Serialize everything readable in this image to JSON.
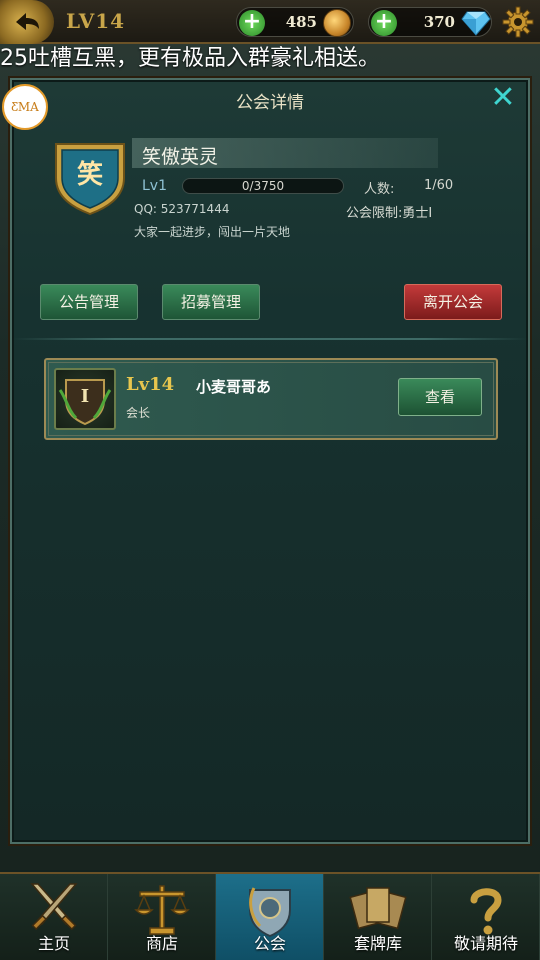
{
  "topbar": {
    "level": "LV14",
    "gold": "485",
    "gems": "370"
  },
  "marquee": "25吐槽互黑，更有极品入群豪礼相送。",
  "dialog": {
    "title": "公会详情",
    "close_label": "✕",
    "logo_text": "ƸMA",
    "guild": {
      "emblem_char": "笑",
      "name": "笑傲英灵",
      "level": "Lv1",
      "xp": "0/3750",
      "xp_fraction": 0,
      "members_label": "人数:",
      "members_value": "1/60",
      "qq": "QQ:  523771444",
      "limit": "公会限制:勇士Ⅰ",
      "motto": "大家一起进步，闯出一片天地"
    },
    "buttons": {
      "announcement": "公告管理",
      "recruit": "招募管理",
      "leave": "离开公会"
    },
    "members": [
      {
        "avatar_rank": "I",
        "level": "Lv14",
        "name": "小麦哥哥あ",
        "role": "会长",
        "view_label": "查看"
      }
    ]
  },
  "nav": {
    "items": [
      {
        "label": "主页",
        "icon": "crossed-swords-icon",
        "active": false
      },
      {
        "label": "商店",
        "icon": "scales-icon",
        "active": false
      },
      {
        "label": "公会",
        "icon": "guild-crest-icon",
        "active": true
      },
      {
        "label": "套牌库",
        "icon": "card-deck-icon",
        "active": false
      },
      {
        "label": "敬请期待",
        "icon": "question-mark-icon",
        "active": false
      }
    ]
  },
  "colors": {
    "accent": "#3fd5d0",
    "gold_text": "#e7c64e",
    "leave_button": "#c33a3a",
    "nav_active": "#1d6f8a"
  }
}
